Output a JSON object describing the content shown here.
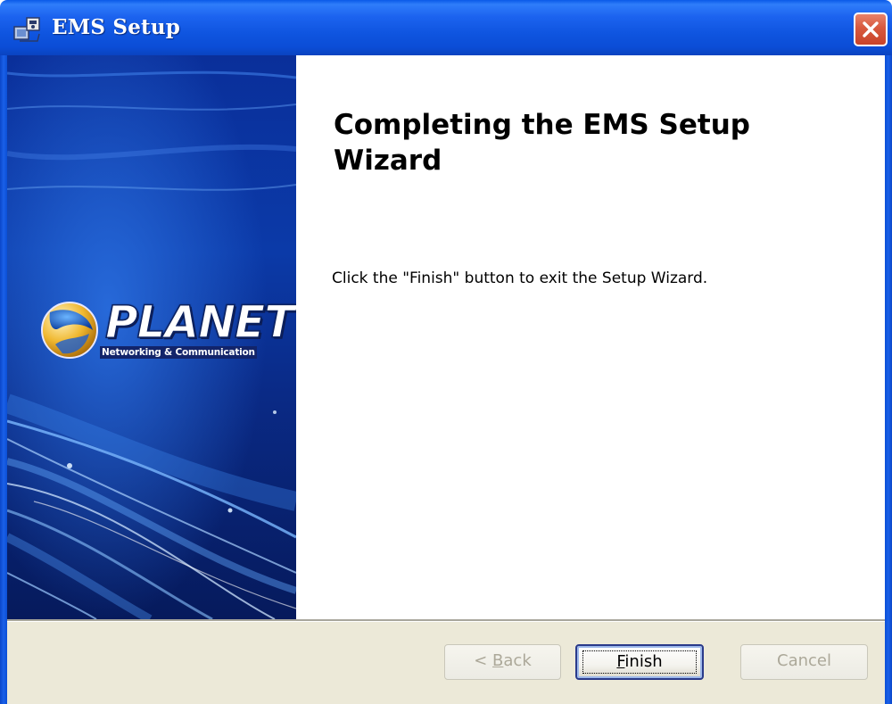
{
  "window": {
    "title": "EMS Setup",
    "app_icon": "installer-icon",
    "close_icon": "close-icon",
    "colors": {
      "titlebar": "#0b4fd6",
      "close": "#d8593e",
      "footer": "#ece9d8"
    }
  },
  "banner": {
    "logo_name": "PLANET",
    "logo_tagline": "Networking & Communication",
    "logo_icon": "planet-globe-icon"
  },
  "content": {
    "heading": "Completing the EMS Setup Wizard",
    "message": "Click the \"Finish\" button to exit the Setup Wizard."
  },
  "buttons": {
    "back": {
      "prefix": "< ",
      "mnemonic": "B",
      "rest": "ack",
      "enabled": false
    },
    "finish": {
      "mnemonic": "F",
      "rest": "inish",
      "enabled": true,
      "default": true
    },
    "cancel": {
      "label": "Cancel",
      "enabled": false
    }
  }
}
